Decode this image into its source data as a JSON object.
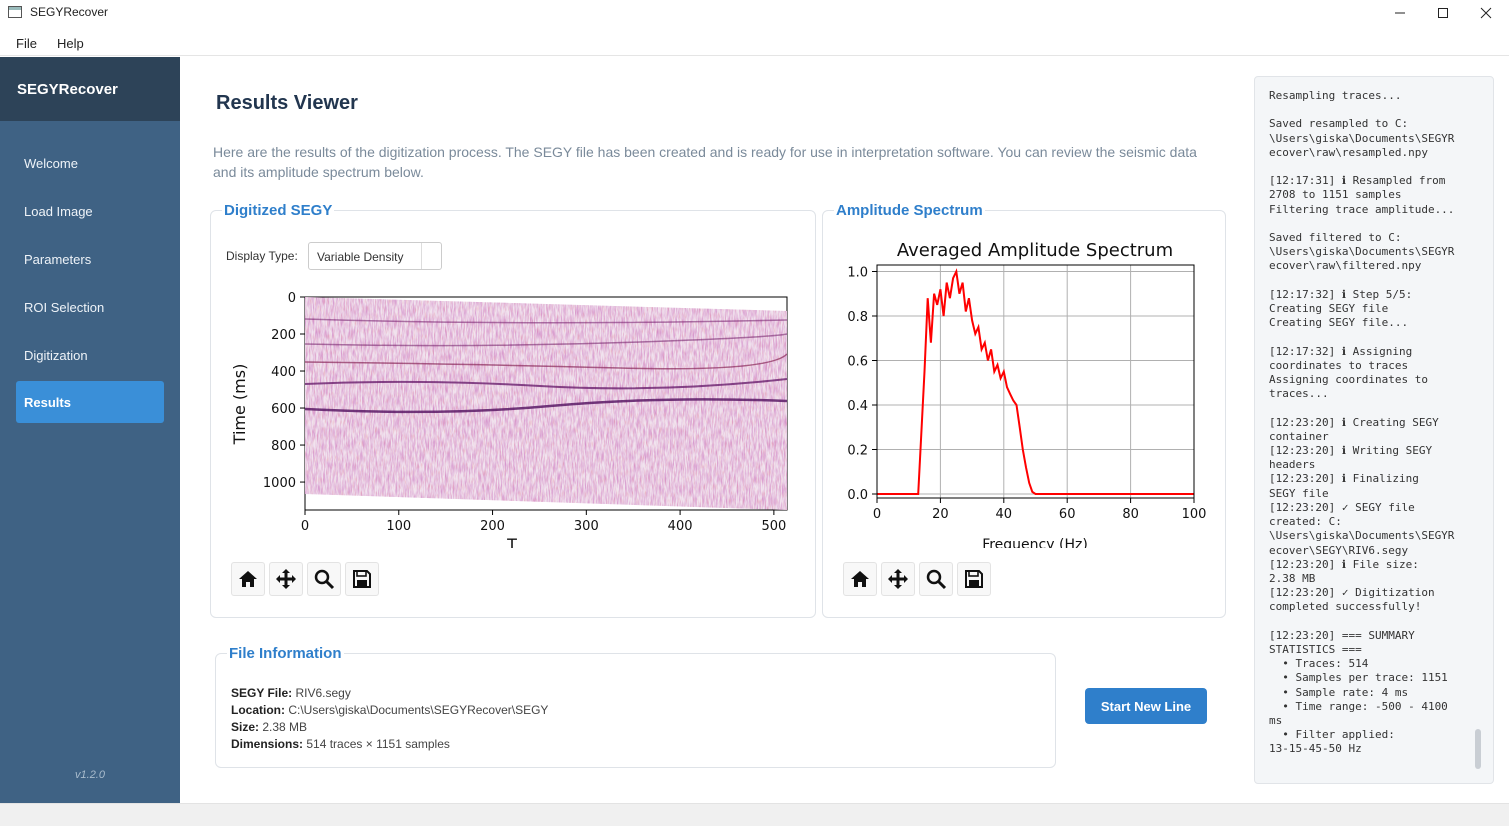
{
  "window": {
    "title": "SEGYRecover"
  },
  "menu": [
    "File",
    "Help"
  ],
  "sidebar": {
    "brand": "SEGYRecover",
    "items": [
      {
        "label": "Welcome",
        "active": false
      },
      {
        "label": "Load Image",
        "active": false
      },
      {
        "label": "Parameters",
        "active": false
      },
      {
        "label": "ROI Selection",
        "active": false
      },
      {
        "label": "Digitization",
        "active": false
      },
      {
        "label": "Results",
        "active": true
      }
    ],
    "version": "v1.2.0"
  },
  "main": {
    "title": "Results Viewer",
    "intro": "Here are the results of the digitization process. The SEGY file has been created and is ready for use in interpretation software. You can review the seismic data and its amplitude spectrum below."
  },
  "segy_panel": {
    "title": "Digitized SEGY",
    "display_type_label": "Display Type:",
    "display_type_value": "Variable Density"
  },
  "spectrum_panel": {
    "title": "Amplitude Spectrum"
  },
  "toolbar_icons": [
    "home-icon",
    "pan-icon",
    "zoom-icon",
    "save-icon"
  ],
  "chart_data": [
    {
      "type": "heatmap",
      "title": "",
      "xlabel": "T",
      "ylabel": "Time (ms)",
      "x_ticks": [
        "0",
        "100",
        "200",
        "300",
        "400",
        "500"
      ],
      "y_ticks": [
        "0",
        "200",
        "400",
        "600",
        "800",
        "1000"
      ],
      "xlim": [
        0,
        514
      ],
      "ylim": [
        1151,
        0
      ],
      "colormap": "seismic",
      "colors": {
        "negative": "#4b1d7a",
        "zero": "#ffffff",
        "positive": "#b8242a"
      }
    },
    {
      "type": "line",
      "title": "Averaged Amplitude Spectrum",
      "xlabel": "Frequency (Hz)",
      "ylabel": "",
      "x_ticks": [
        "0",
        "20",
        "40",
        "60",
        "80",
        "100"
      ],
      "y_ticks": [
        "0.0",
        "0.2",
        "0.4",
        "0.6",
        "0.8",
        "1.0"
      ],
      "xlim": [
        0,
        100
      ],
      "ylim": [
        0,
        1.0
      ],
      "grid": true,
      "color": "#ff0000",
      "x": [
        0,
        13,
        15,
        16,
        17,
        18,
        19,
        20,
        21,
        22,
        23,
        24,
        25,
        26,
        27,
        28,
        29,
        30,
        31,
        32,
        33,
        34,
        35,
        36,
        37,
        38,
        39,
        40,
        41,
        42,
        43,
        44,
        45,
        46,
        47,
        48,
        49,
        50,
        100
      ],
      "y": [
        0,
        0,
        0.55,
        0.88,
        0.68,
        0.9,
        0.85,
        0.92,
        0.8,
        0.95,
        0.88,
        0.97,
        1.0,
        0.9,
        0.95,
        0.82,
        0.88,
        0.78,
        0.72,
        0.75,
        0.65,
        0.68,
        0.6,
        0.65,
        0.55,
        0.58,
        0.52,
        0.55,
        0.48,
        0.45,
        0.42,
        0.4,
        0.3,
        0.2,
        0.12,
        0.05,
        0.01,
        0,
        0
      ]
    }
  ],
  "file_info": {
    "title": "File Information",
    "rows": [
      {
        "label": "SEGY File:",
        "value": "RIV6.segy"
      },
      {
        "label": "Location:",
        "value": "C:\\Users\\giska\\Documents\\SEGYRecover\\SEGY"
      },
      {
        "label": "Size:",
        "value": "2.38 MB"
      },
      {
        "label": "Dimensions:",
        "value": "514 traces × 1151 samples"
      }
    ]
  },
  "start_button": "Start New Line",
  "log_text": "Resampling traces...\n\nSaved resampled to C:\n\\Users\\giska\\Documents\\SEGYR\necover\\raw\\resampled.npy\n\n[12:17:31] ℹ Resampled from\n2708 to 1151 samples\nFiltering trace amplitude...\n\nSaved filtered to C:\n\\Users\\giska\\Documents\\SEGYR\necover\\raw\\filtered.npy\n\n[12:17:32] ℹ Step 5/5:\nCreating SEGY file\nCreating SEGY file...\n\n[12:17:32] ℹ Assigning\ncoordinates to traces\nAssigning coordinates to\ntraces...\n\n[12:23:20] ℹ Creating SEGY\ncontainer\n[12:23:20] ℹ Writing SEGY\nheaders\n[12:23:20] ℹ Finalizing\nSEGY file\n[12:23:20] ✓ SEGY file\ncreated: C:\n\\Users\\giska\\Documents\\SEGYR\necover\\SEGY\\RIV6.segy\n[12:23:20] ℹ File size:\n2.38 MB\n[12:23:20] ✓ Digitization\ncompleted successfully!\n\n[12:23:20] === SUMMARY\nSTATISTICS ===\n  • Traces: 514\n  • Samples per trace: 1151\n  • Sample rate: 4 ms\n  • Time range: -500 - 4100\nms\n  • Filter applied:\n13-15-45-50 Hz"
}
